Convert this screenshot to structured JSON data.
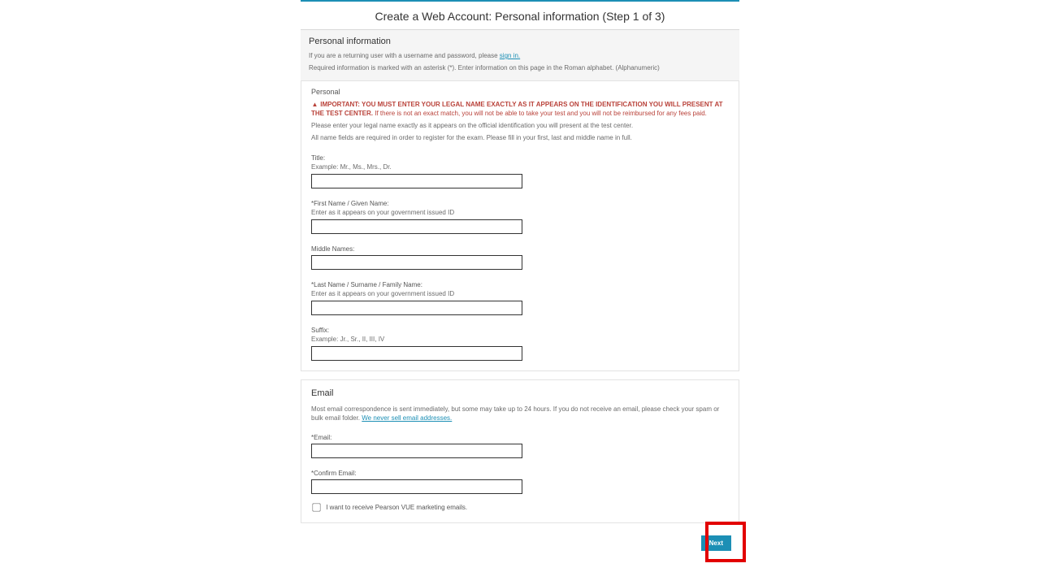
{
  "title": "Create a Web Account: Personal information (Step 1 of 3)",
  "header": {
    "heading": "Personal information",
    "returning_prefix": "If you are a returning user with a username and password, please ",
    "signin_link": "sign in.",
    "required_note": "Required information is marked with an asterisk (*). Enter information on this page in the Roman alphabet. (Alphanumeric)"
  },
  "personal": {
    "subheading": "Personal",
    "warn_bold": "IMPORTANT: YOU MUST ENTER YOUR LEGAL NAME EXACTLY AS IT APPEARS ON THE IDENTIFICATION YOU WILL PRESENT AT THE TEST CENTER.",
    "warn_rest": " If there is not an exact match, you will not be able to take your test and you will not be reimbursed for any fees paid.",
    "info1": "Please enter your legal name exactly as it appears on the official identification you will present at the test center.",
    "info2": "All name fields are required in order to register for the exam. Please fill in your first, last and middle name in full.",
    "fields": {
      "title_label": "Title:",
      "title_hint": "Example: Mr., Ms., Mrs., Dr.",
      "first_label": "*First Name / Given Name:",
      "first_hint": "Enter as it appears on your government issued ID",
      "middle_label": "Middle Names:",
      "last_label": "*Last Name / Surname / Family Name:",
      "last_hint": "Enter as it appears on your government issued ID",
      "suffix_label": "Suffix:",
      "suffix_hint": "Example: Jr., Sr., II, III, IV"
    }
  },
  "email": {
    "heading": "Email",
    "note_prefix": "Most email correspondence is sent immediately, but some may take up to 24 hours. If you do not receive an email, please check your spam or bulk email folder. ",
    "policy_link": "We never sell email addresses.",
    "email_label": "*Email:",
    "confirm_label": "*Confirm Email:",
    "optin_label": "I want to receive Pearson VUE marketing emails."
  },
  "footer": {
    "next": "Next"
  }
}
